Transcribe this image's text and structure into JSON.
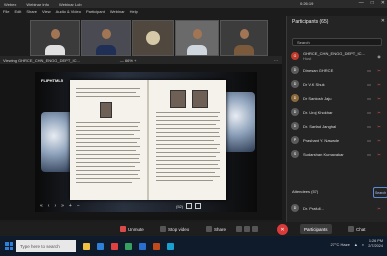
{
  "window": {
    "title_tabs": [
      "Webex",
      "Webinar Info",
      "Webinar Lob"
    ],
    "time": "0:26:19",
    "controls": [
      "—",
      "□",
      "✕"
    ]
  },
  "menu": [
    "File",
    "Edit",
    "Share",
    "View",
    "Audio & Video",
    "Participant",
    "Webinar",
    "Help"
  ],
  "share_bar": {
    "title": "Viewing GHRCE_CHN_ENGG_DEPT_IC...",
    "zoom": "— 66% +",
    "more": "⋯"
  },
  "book": {
    "label": "FLIPHTML5"
  },
  "page_controls": {
    "first": "«",
    "prev": "‹",
    "next": "›",
    "last": "»",
    "zoom_in": "+",
    "zoom_out": "−",
    "page_indicator": "(52)"
  },
  "participants_panel": {
    "title": "Participants (65)",
    "search_placeholder": "Search",
    "rows": [
      {
        "name": "GHRCE_CHN_ENGG_DEPT_IC...",
        "sub": "Host",
        "avatar": "G"
      },
      {
        "name": "Dinesan GHRCE",
        "avatar": "D"
      },
      {
        "name": "Dr V.K Shuk",
        "avatar": "D"
      },
      {
        "name": "Dr Santosh Jaju",
        "avatar": "D"
      },
      {
        "name": "Dr. Uroj Khokhar",
        "avatar": "D"
      },
      {
        "name": "Dr. Sarfad Janghal",
        "avatar": "D"
      },
      {
        "name": "Prashant Y. Nawade",
        "avatar": "P"
      },
      {
        "name": "Sudarshan Kumavakar",
        "avatar": "S"
      },
      {
        "name": "Dr. Prafull...",
        "avatar": "D"
      }
    ],
    "attendees_label": "Attendees (57)",
    "attendees_button": "Search"
  },
  "toolbar": {
    "unmute": "Unmute",
    "stop_video": "Stop video",
    "share": "Share",
    "participants": "Participants",
    "chat": "Chat",
    "end": "✕"
  },
  "taskbar": {
    "search": "Type here to search",
    "weather": "27°C Haze",
    "time": "1:26 PM",
    "date": "2/7/2024"
  },
  "colors": {
    "accent": "#2d7fd8",
    "end_call": "#d93a3a",
    "background": "#1c1c1c"
  }
}
